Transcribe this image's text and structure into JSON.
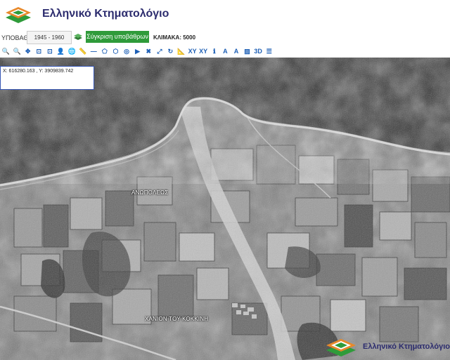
{
  "header": {
    "brand": "Ελληνικό Κτηματολόγιο"
  },
  "controls": {
    "base_label": "ΥΠΟΒΑΘΡΟ:",
    "year_select": "1945 - 1960",
    "compare_button": "Σύγκριση υποβάθρων",
    "scale_label": "ΚΛΙΜΑΚΑ: 5000"
  },
  "toolbar": {
    "tools": [
      {
        "name": "zoom-in-icon",
        "glyph": "🔍"
      },
      {
        "name": "zoom-out-icon",
        "glyph": "🔍"
      },
      {
        "name": "pan-icon",
        "glyph": "✥"
      },
      {
        "name": "zoom-box-icon",
        "glyph": "⊡"
      },
      {
        "name": "full-extent-icon",
        "glyph": "⊡"
      },
      {
        "name": "user-icon",
        "glyph": "👤"
      },
      {
        "name": "globe-icon",
        "glyph": "🌐"
      },
      {
        "name": "ruler-icon",
        "glyph": "📏"
      },
      {
        "name": "line-icon",
        "glyph": "—"
      },
      {
        "name": "polygon-icon",
        "glyph": "⬠"
      },
      {
        "name": "shape-icon",
        "glyph": "⬡"
      },
      {
        "name": "locate-icon",
        "glyph": "◎"
      },
      {
        "name": "arrow-icon",
        "glyph": "▶"
      },
      {
        "name": "delete-icon",
        "glyph": "✖"
      },
      {
        "name": "expand-icon",
        "glyph": "⤢"
      },
      {
        "name": "refresh-icon",
        "glyph": "↻"
      },
      {
        "name": "measure-icon",
        "glyph": "📐"
      },
      {
        "name": "xy-icon",
        "glyph": "XY"
      },
      {
        "name": "xy-point-icon",
        "glyph": "XY"
      },
      {
        "name": "info-icon",
        "glyph": "ℹ"
      },
      {
        "name": "text-icon",
        "glyph": "A"
      },
      {
        "name": "label-icon",
        "glyph": "A"
      },
      {
        "name": "image-icon",
        "glyph": "▨"
      },
      {
        "name": "3d-icon",
        "glyph": "3D"
      },
      {
        "name": "layers-list-icon",
        "glyph": "☰"
      }
    ]
  },
  "map": {
    "coords": "X: 616280.163 , Y: 3909839.742",
    "places": [
      "ΑΝΩΠΟΛΕΩΣ",
      "ΧΑΝΙΟΝ ΤΟΥ ΚΟΚΚΙΝΗ"
    ]
  },
  "watermark": {
    "brand": "Ελληνικό Κτηματολόγιο"
  },
  "colors": {
    "logo_green": "#2f9b3a",
    "logo_orange": "#e8892a",
    "brand_text": "#2c2c6e",
    "accent_blue": "#3656b5"
  }
}
